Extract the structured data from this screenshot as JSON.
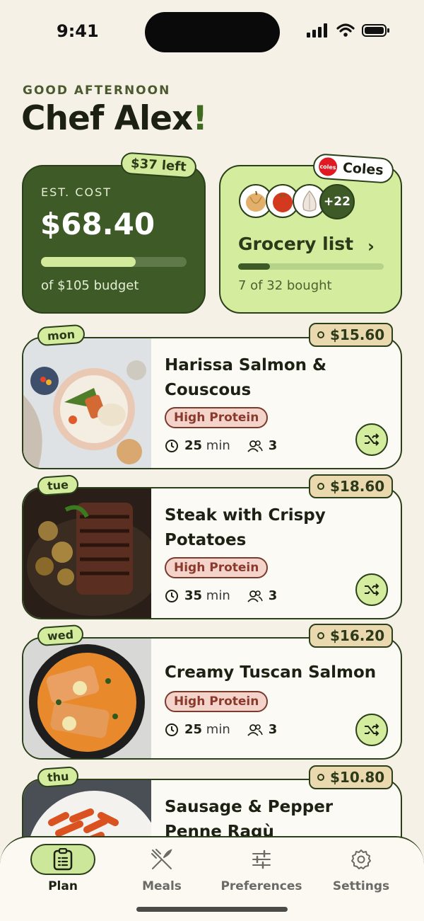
{
  "status": {
    "time": "9:41"
  },
  "greeting": {
    "label": "GOOD AFTERNOON",
    "name": "Chef Alex",
    "exclaim": "!"
  },
  "cost_card": {
    "tag": "$37 left",
    "label": "EST. COST",
    "amount": "$68.40",
    "budget_text": "of $105 budget",
    "budget_used_fraction": 0.65
  },
  "grocery_card": {
    "store": "Coles",
    "store_logo_text": "coles",
    "more_count": "+22",
    "title": "Grocery list",
    "progress_text": "7 of 32 bought",
    "progress_fraction": 0.22,
    "items": [
      "onion-icon",
      "tomato-icon",
      "garlic-icon"
    ]
  },
  "meals": [
    {
      "day": "mon",
      "price": "$15.60",
      "title": "Harissa Salmon & Couscous",
      "tag": "High Protein",
      "time": "25",
      "time_unit": "min",
      "servings": "3"
    },
    {
      "day": "tue",
      "price": "$18.60",
      "title": "Steak with Crispy Potatoes",
      "tag": "High Protein",
      "time": "35",
      "time_unit": "min",
      "servings": "3"
    },
    {
      "day": "wed",
      "price": "$16.20",
      "title": "Creamy Tuscan Salmon",
      "tag": "High Protein",
      "time": "25",
      "time_unit": "min",
      "servings": "3"
    },
    {
      "day": "thu",
      "price": "$10.80",
      "title": "Sausage & Pepper Penne Ragù"
    }
  ],
  "tabs": [
    {
      "label": "Plan",
      "icon": "clipboard-icon",
      "active": true
    },
    {
      "label": "Meals",
      "icon": "utensils-icon",
      "active": false
    },
    {
      "label": "Preferences",
      "icon": "sliders-icon",
      "active": false
    },
    {
      "label": "Settings",
      "icon": "gear-icon",
      "active": false
    }
  ],
  "colors": {
    "background": "#f5f1e6",
    "dark_green": "#3d5a27",
    "light_green": "#d3ec9e",
    "price_tag": "#ead9ae",
    "protein_tag": "#f4d3cb"
  }
}
